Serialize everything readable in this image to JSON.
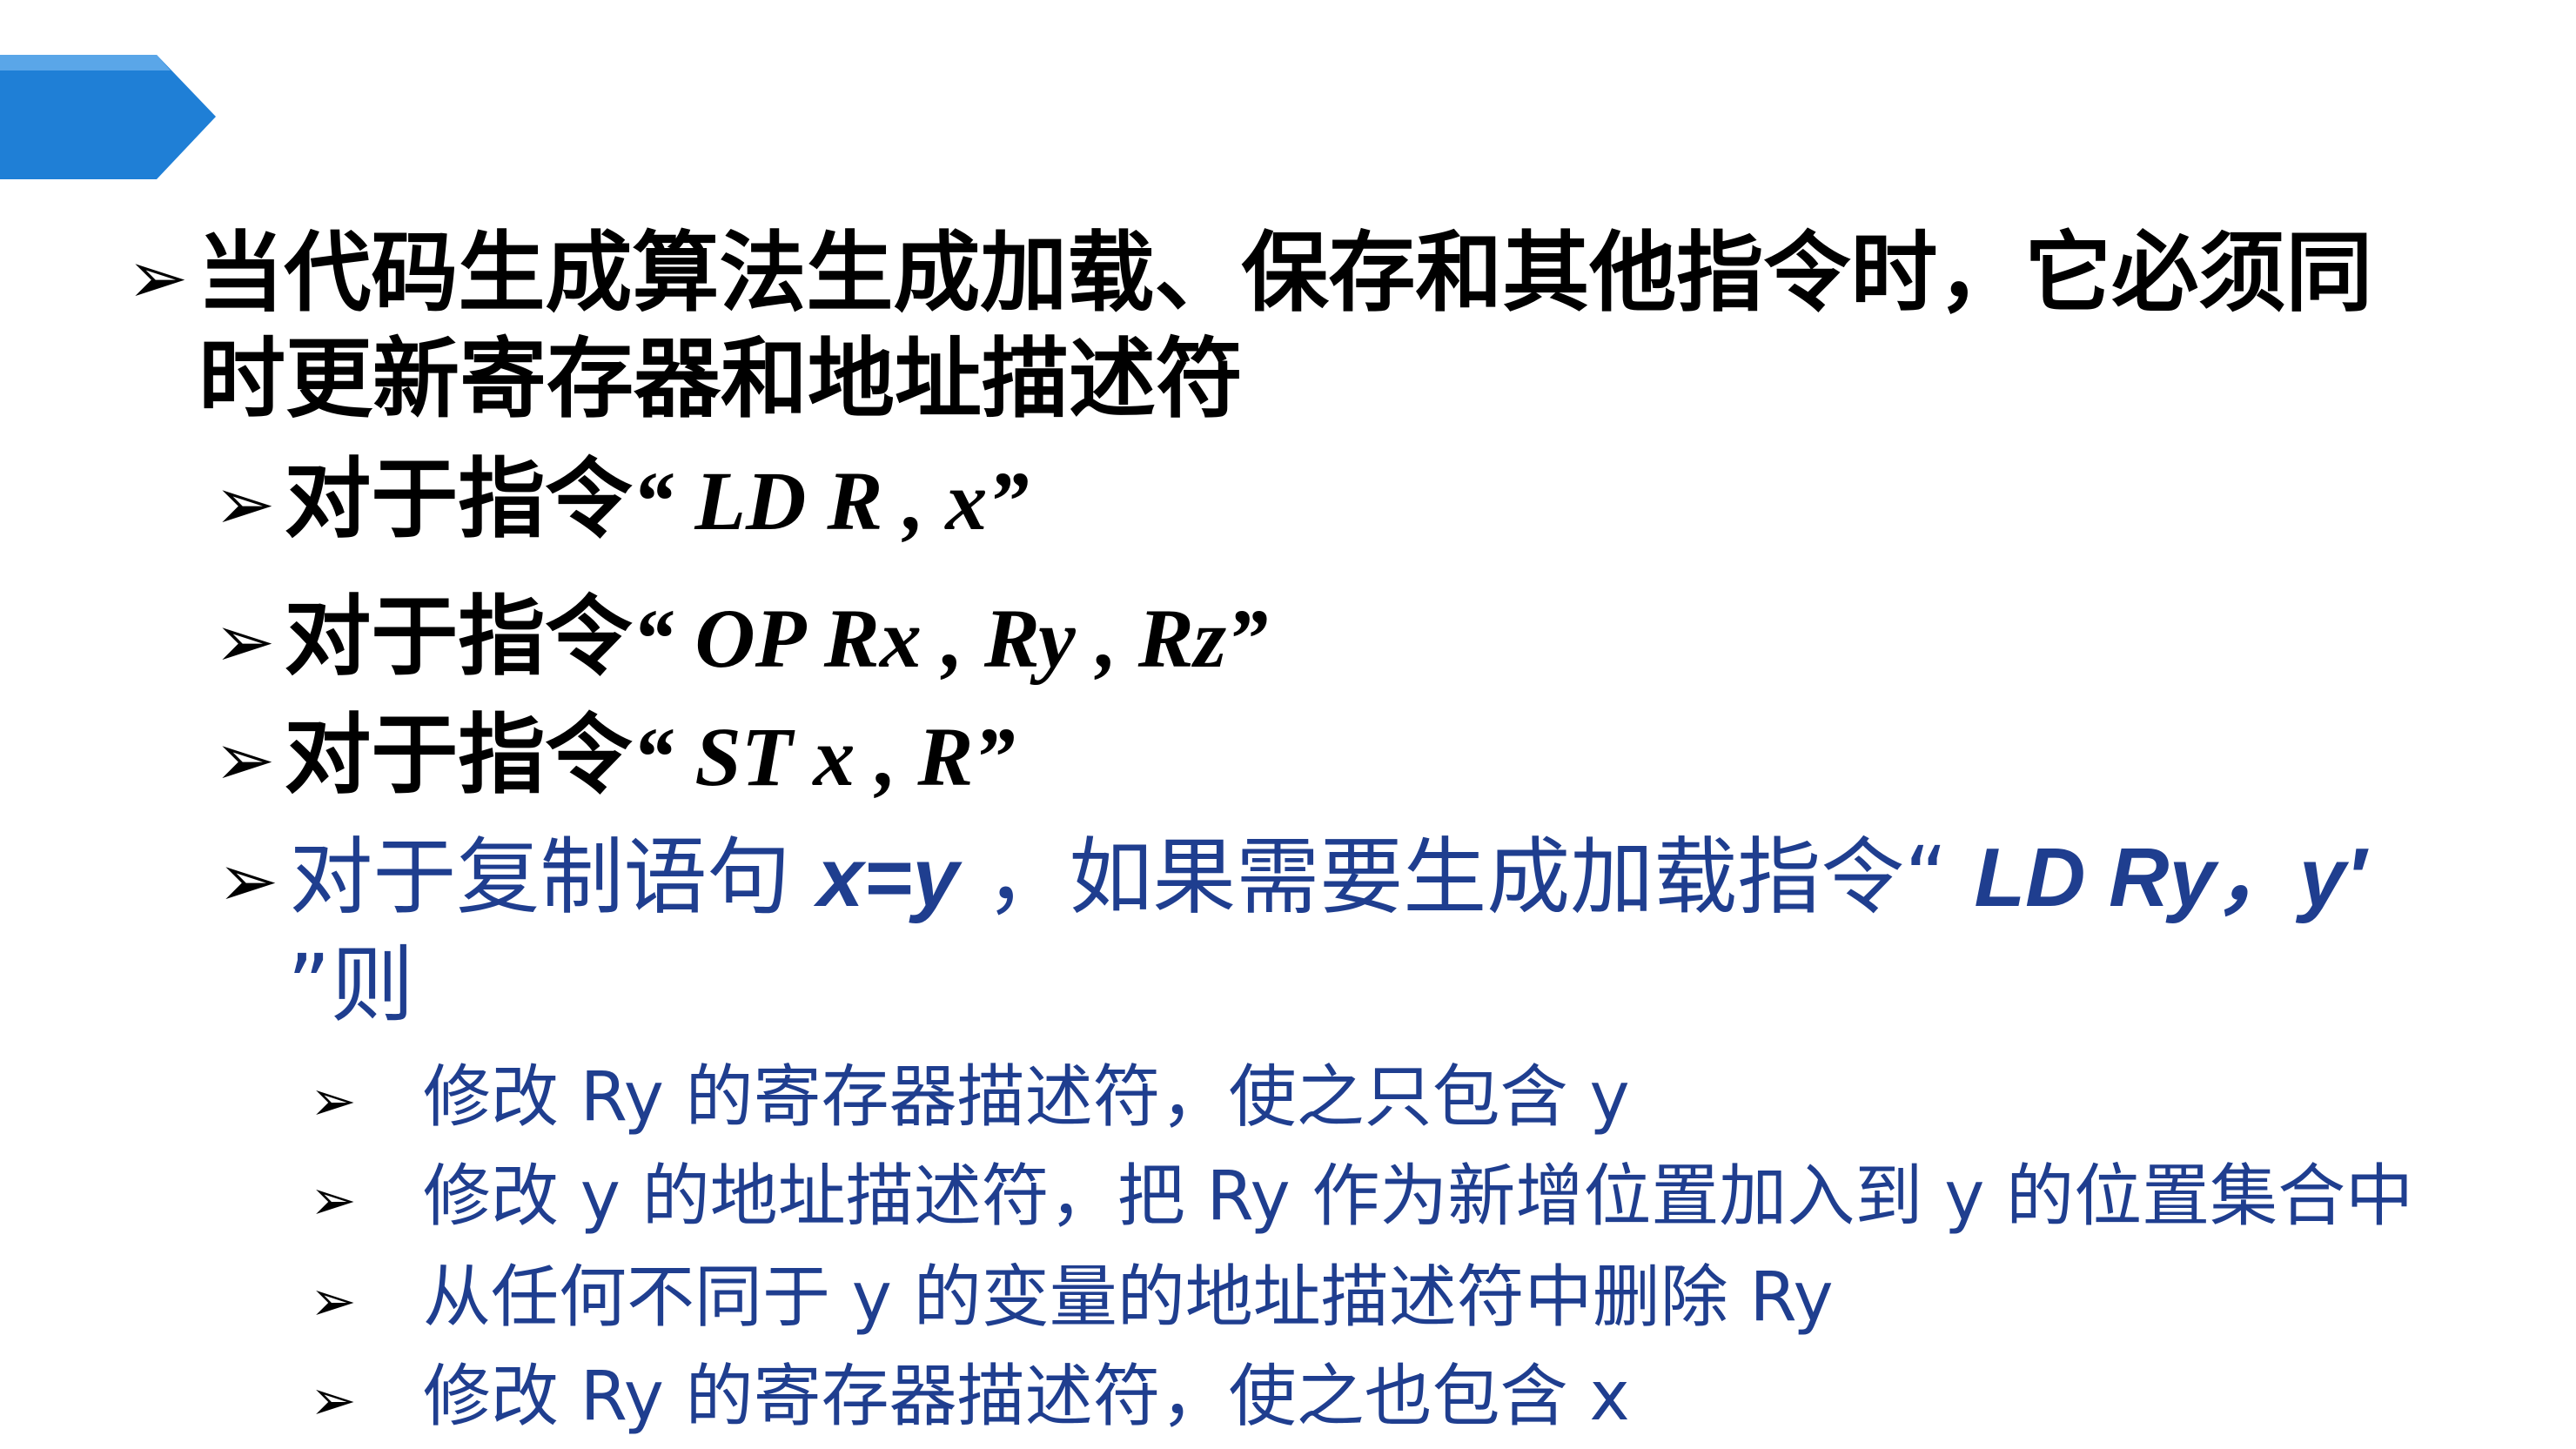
{
  "banner": {
    "color": "#1f7fd6",
    "highlight": "#5aa6e8"
  },
  "bullet_glyph": "➢",
  "point1": {
    "line1": "当代码生成算法生成加载、保存和其他指令时，它必须同",
    "line2": "时更新寄存器和地址描述符"
  },
  "instr_ld": {
    "prefix": "对于指令",
    "code": "“ LD  R , x”"
  },
  "instr_op": {
    "prefix": "对于指令",
    "code": "“ OP  Rx ,  Ry ,  Rz”"
  },
  "instr_st": {
    "prefix": "对于指令",
    "code": "“ ST   x , R”"
  },
  "copy_stmt": {
    "text_a": "对于复制语句 ",
    "code_a": "x=y",
    "text_b": " ，如果需要生成加载指令“ ",
    "code_b": "LD Ry，y′",
    "line2": "”则"
  },
  "steps": [
    "修改   Ry 的寄存器描述符，使之只包含   y",
    "修改   y 的地址描述符，把 Ry 作为新增位置加入到   y 的位置集合中",
    "从任何不同于 y 的变量的地址描述符中删除 Ry",
    "修改   Ry 的寄存器描述符，使之也包含 x"
  ]
}
